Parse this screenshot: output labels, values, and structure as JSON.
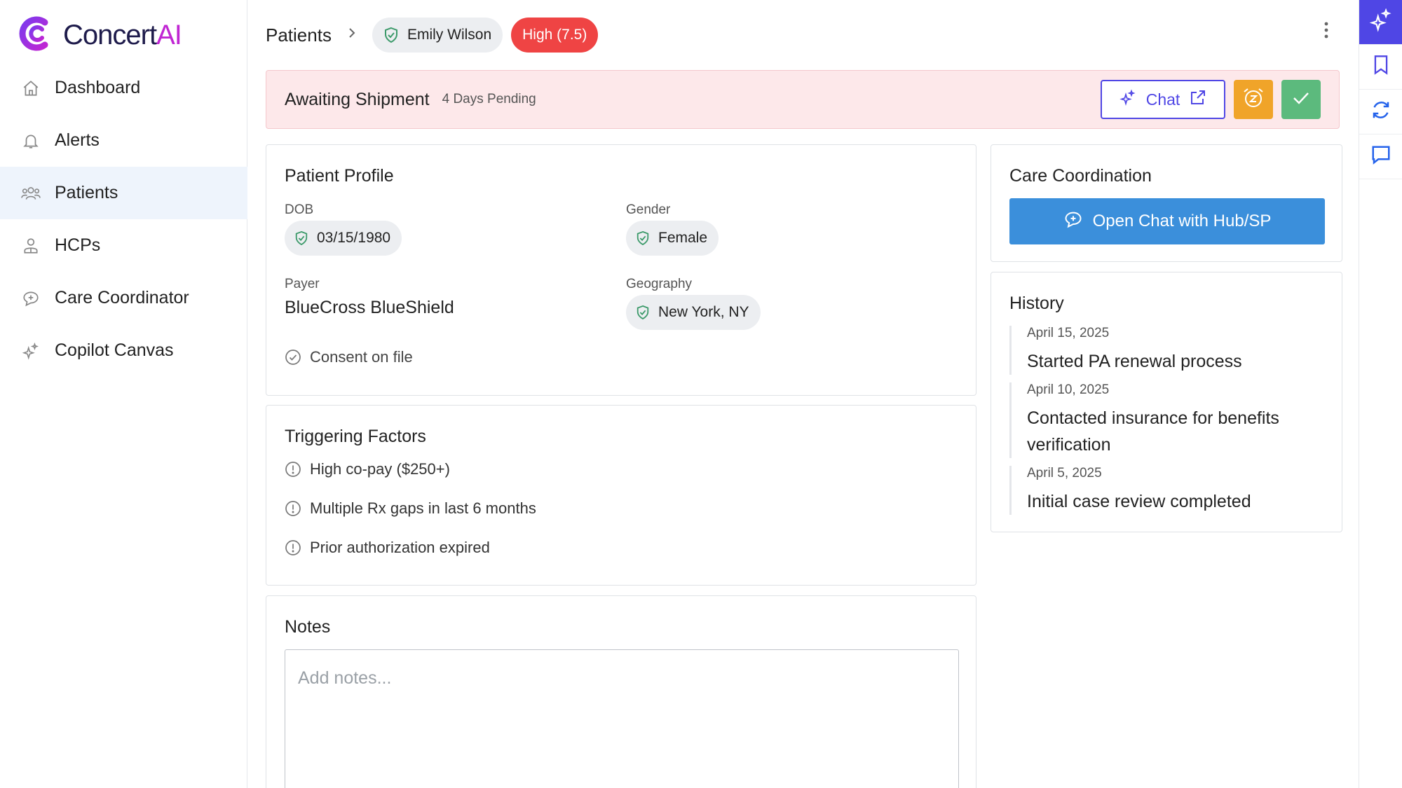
{
  "brand": {
    "name_main": "Concert",
    "name_accent": "AI",
    "accent_color": "#c026d3",
    "mark_color": "#7c3aed"
  },
  "sidebar": {
    "items": [
      {
        "label": "Dashboard",
        "icon": "home-icon",
        "active": false
      },
      {
        "label": "Alerts",
        "icon": "bell-icon",
        "active": false
      },
      {
        "label": "Patients",
        "icon": "users-icon",
        "active": true
      },
      {
        "label": "HCPs",
        "icon": "doctor-icon",
        "active": false
      },
      {
        "label": "Care Coordinator",
        "icon": "chat-plus-icon",
        "active": false
      },
      {
        "label": "Copilot Canvas",
        "icon": "sparkle-icon",
        "active": false
      }
    ]
  },
  "breadcrumb": {
    "root": "Patients",
    "patient": "Emily Wilson",
    "risk": "High (7.5)",
    "risk_color": "#ef4444"
  },
  "banner": {
    "status": "Awaiting Shipment",
    "pending": "4 Days Pending",
    "chat_label": "Chat"
  },
  "profile": {
    "title": "Patient Profile",
    "dob_label": "DOB",
    "dob": "03/15/1980",
    "gender_label": "Gender",
    "gender": "Female",
    "payer_label": "Payer",
    "payer": "BlueCross BlueShield",
    "geo_label": "Geography",
    "geo": "New York, NY",
    "consent": "Consent on file"
  },
  "factors": {
    "title": "Triggering Factors",
    "items": [
      "High co-pay ($250+)",
      "Multiple Rx gaps in last 6 months",
      "Prior authorization expired"
    ]
  },
  "notes": {
    "title": "Notes",
    "placeholder": "Add notes..."
  },
  "care": {
    "title": "Care Coordination",
    "button": "Open Chat with Hub/SP"
  },
  "history": {
    "title": "History",
    "items": [
      {
        "date": "April 15, 2025",
        "text": "Started PA renewal process"
      },
      {
        "date": "April 10, 2025",
        "text": "Contacted insurance for benefits verification"
      },
      {
        "date": "April 5, 2025",
        "text": "Initial case review completed"
      }
    ]
  },
  "rail": {
    "icons": [
      "ai-sparkle-icon",
      "bookmark-icon",
      "refresh-icon",
      "comment-icon"
    ]
  }
}
